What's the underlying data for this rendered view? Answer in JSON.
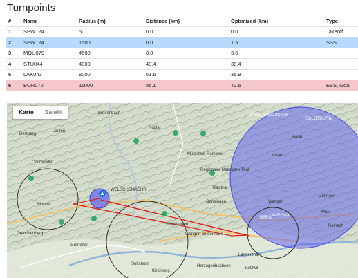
{
  "page": {
    "title": "Turnpoints"
  },
  "table": {
    "headers": [
      "#",
      "Name",
      "Radius (m)",
      "Distance (km)",
      "Optimized (km)",
      "Type"
    ],
    "rows": [
      [
        "1",
        "SPW124",
        "50",
        "0.0",
        "0.0",
        "Takeoff"
      ],
      [
        "2",
        "SPW124",
        "1500",
        "0.0",
        "1.5",
        "SSS"
      ],
      [
        "3",
        "MOU079",
        "4500",
        "8.0",
        "3.6",
        ""
      ],
      [
        "4",
        "STU044",
        "4000",
        "43.4",
        "30.4",
        ""
      ],
      [
        "5",
        "LAK043",
        "8000",
        "61.6",
        "36.9",
        ""
      ],
      [
        "6",
        "BOR072",
        "11000",
        "86.1",
        "42.6",
        "ESS, Goal"
      ]
    ]
  },
  "map": {
    "tab_map": "Karte",
    "tab_satellite": "Satellit",
    "place_labels": {
      "breitenbach": "Breitenbach",
      "delsberg": "Delsberg",
      "courrendlin": "Courrendlin",
      "moutier": "Moutier",
      "grenchenberg": "Grenchenberg",
      "grenchen": "Grenchen",
      "solothurn": "Solothurn",
      "wiedlisbach": "Wiedlisbach",
      "wangen": "Wangen an der Aare",
      "langenthal": "Langenthal",
      "aarau": "Aarau",
      "olten": "Olten",
      "zofingen": "Zofingen",
      "basel_landschaft": "BASEL-LANDSCHAFT",
      "solothurn_canton": "SOLOTHURN",
      "aargau": "AARGAU",
      "bern": "BERN",
      "muri": "Muri",
      "kirchberg": "Kirchberg",
      "herzogenbuchsee": "Herzogenbuchsee",
      "lotzwil": "Lotzwil",
      "oensingen": "Oensingen",
      "balsthal": "Balsthal",
      "mumliswil": "Mümliswil-Ramiswil",
      "regional_naturpark": "Regionaler Naturpark Thal",
      "welschenrohr": "WELSCHENROHR",
      "laufen": "Laufen",
      "nuglar": "Nuglar",
      "wangen_short": "Wangen",
      "reinach": "Reinach"
    },
    "colors": {
      "route": "#e0201b",
      "circle_fill": "#5a5cf0",
      "circle_outline": "#222222"
    }
  }
}
